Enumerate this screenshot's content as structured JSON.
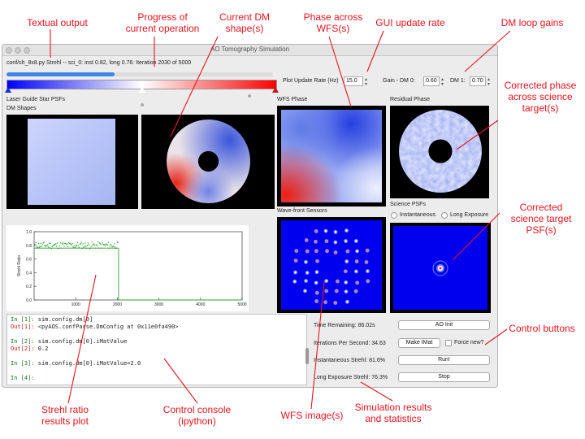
{
  "annotations": {
    "textual_output": "Textual output",
    "progress": "Progress of\ncurrent operation",
    "dm_shape": "Current DM\nshape(s)",
    "phase_wfs": "Phase across\nWFS(s)",
    "gui_rate": "GUI update rate",
    "dm_gains": "DM loop gains",
    "corrected_phase": "Corrected phase\nacross science\ntarget(s)",
    "corrected_psf": "Corrected\nscience target\nPSF(s)",
    "control_buttons": "Control buttons",
    "strehl_plot": "Strehl ratio\nresults plot",
    "console": "Control console\n(ipython)",
    "wfs_image": "WFS image(s)",
    "sim_results": "Simulation results\nand statistics"
  },
  "window": {
    "title": "AO Tomography Simulation"
  },
  "status_text": "conf/sh_8x8.py   Strehl -- sci_0: inst 0.82, long 0.76: Iteration 2030 of 5000",
  "progress": {
    "value": 0.406
  },
  "controls": {
    "plot_rate_label": "Plot Update Rate (Hz)",
    "plot_rate_value": "15.0",
    "gain_label": "Gain -  DM 0:",
    "dm0_gain": "0.60",
    "dm1_label": "DM 1:",
    "dm1_gain": "0.70"
  },
  "panels": {
    "lgs_psfs": "Laser Guide Star PSFs",
    "dm_shapes": "DM Shapes",
    "wfs_phase": "WFS Phase",
    "residual_phase": "Residual Phase",
    "wfs_sensors": "Wave-front Sensors",
    "science_psfs": "Science PSFs",
    "instantaneous": "Instantaneous",
    "long_exposure": "Long Exposure"
  },
  "chart_data": {
    "type": "scatter",
    "ylabel": "Strehl Ratio",
    "xlim": [
      0,
      5000
    ],
    "ylim": [
      0.0,
      1.0
    ],
    "xticks": [
      "1000",
      "2000",
      "3000",
      "4000",
      "5000"
    ],
    "yticks": [
      "0.0",
      "0.2",
      "0.4",
      "0.6",
      "0.8",
      "1.0"
    ],
    "series": [
      {
        "style": "instantaneous-points",
        "x_start": 0,
        "x_end": 2030,
        "mean": 0.8,
        "spread": 0.05,
        "color": "#2ca02c"
      },
      {
        "style": "long-exposure-line",
        "x_start": 0,
        "x_end": 2030,
        "value": 0.76,
        "color": "#2ca02c"
      }
    ]
  },
  "console": {
    "lines": [
      {
        "p": "In [1]:",
        "t": " sim.config.dm[0]",
        "kind": "in"
      },
      {
        "p": "Out[1]:",
        "t": " <pyAOS.confParse.DmConfig at 0x11e0fa490>",
        "kind": "out"
      },
      {
        "p": "",
        "t": "",
        "kind": "blank"
      },
      {
        "p": "In [2]:",
        "t": " sim.config.dm[0].iMatValue",
        "kind": "in"
      },
      {
        "p": "Out[2]:",
        "t": " 0.2",
        "kind": "out"
      },
      {
        "p": "",
        "t": "",
        "kind": "blank"
      },
      {
        "p": "In [3]:",
        "t": " sim.config.dm[0].iMatValue=2.0",
        "kind": "in"
      },
      {
        "p": "",
        "t": "",
        "kind": "blank"
      },
      {
        "p": "In [4]:",
        "t": "",
        "kind": "in"
      }
    ]
  },
  "stats": {
    "time_remaining": "Time Remaining: 86.02s",
    "iterations_per_second": "Iterations Per Second: 34.63",
    "inst_strehl": "Instantaneous Strehl: 81.6%",
    "long_strehl": "Long Exposure Strehl: 76.3%"
  },
  "buttons": {
    "ao_init": "AO Init",
    "make_imat": "Make IMat",
    "force_new": "Force new?",
    "run": "Run!",
    "stop": "Stop"
  },
  "colors": {
    "accent": "#e8141e",
    "progress": "#3f86e8",
    "psf_background": "#0000ee"
  }
}
